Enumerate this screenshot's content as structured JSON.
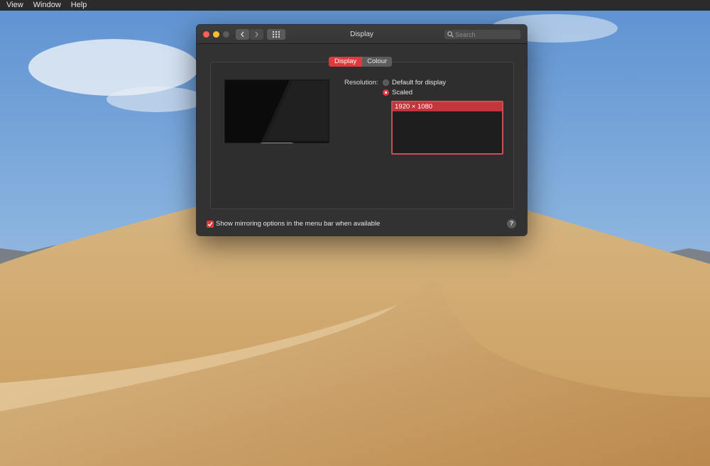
{
  "menubar": {
    "items": [
      "View",
      "Window",
      "Help"
    ]
  },
  "window": {
    "title": "Display",
    "search_placeholder": "Search",
    "tabs": [
      "Display",
      "Colour"
    ],
    "active_tab": "Display",
    "resolution": {
      "label": "Resolution:",
      "options": [
        "Default for display",
        "Scaled"
      ],
      "selected": "Scaled",
      "list": [
        "1920 × 1080"
      ],
      "selected_item": "1920 × 1080"
    },
    "mirroring_checkbox": {
      "label": "Show mirroring options in the menu bar when available",
      "checked": true
    },
    "help_label": "?"
  },
  "colors": {
    "accent": "#e0393e",
    "window_bg": "#323232"
  },
  "icons": [
    "close-icon",
    "minimize-icon",
    "zoom-icon",
    "chevron-left-icon",
    "chevron-right-icon",
    "grid-icon",
    "search-icon",
    "checkmark-icon",
    "help-icon"
  ]
}
